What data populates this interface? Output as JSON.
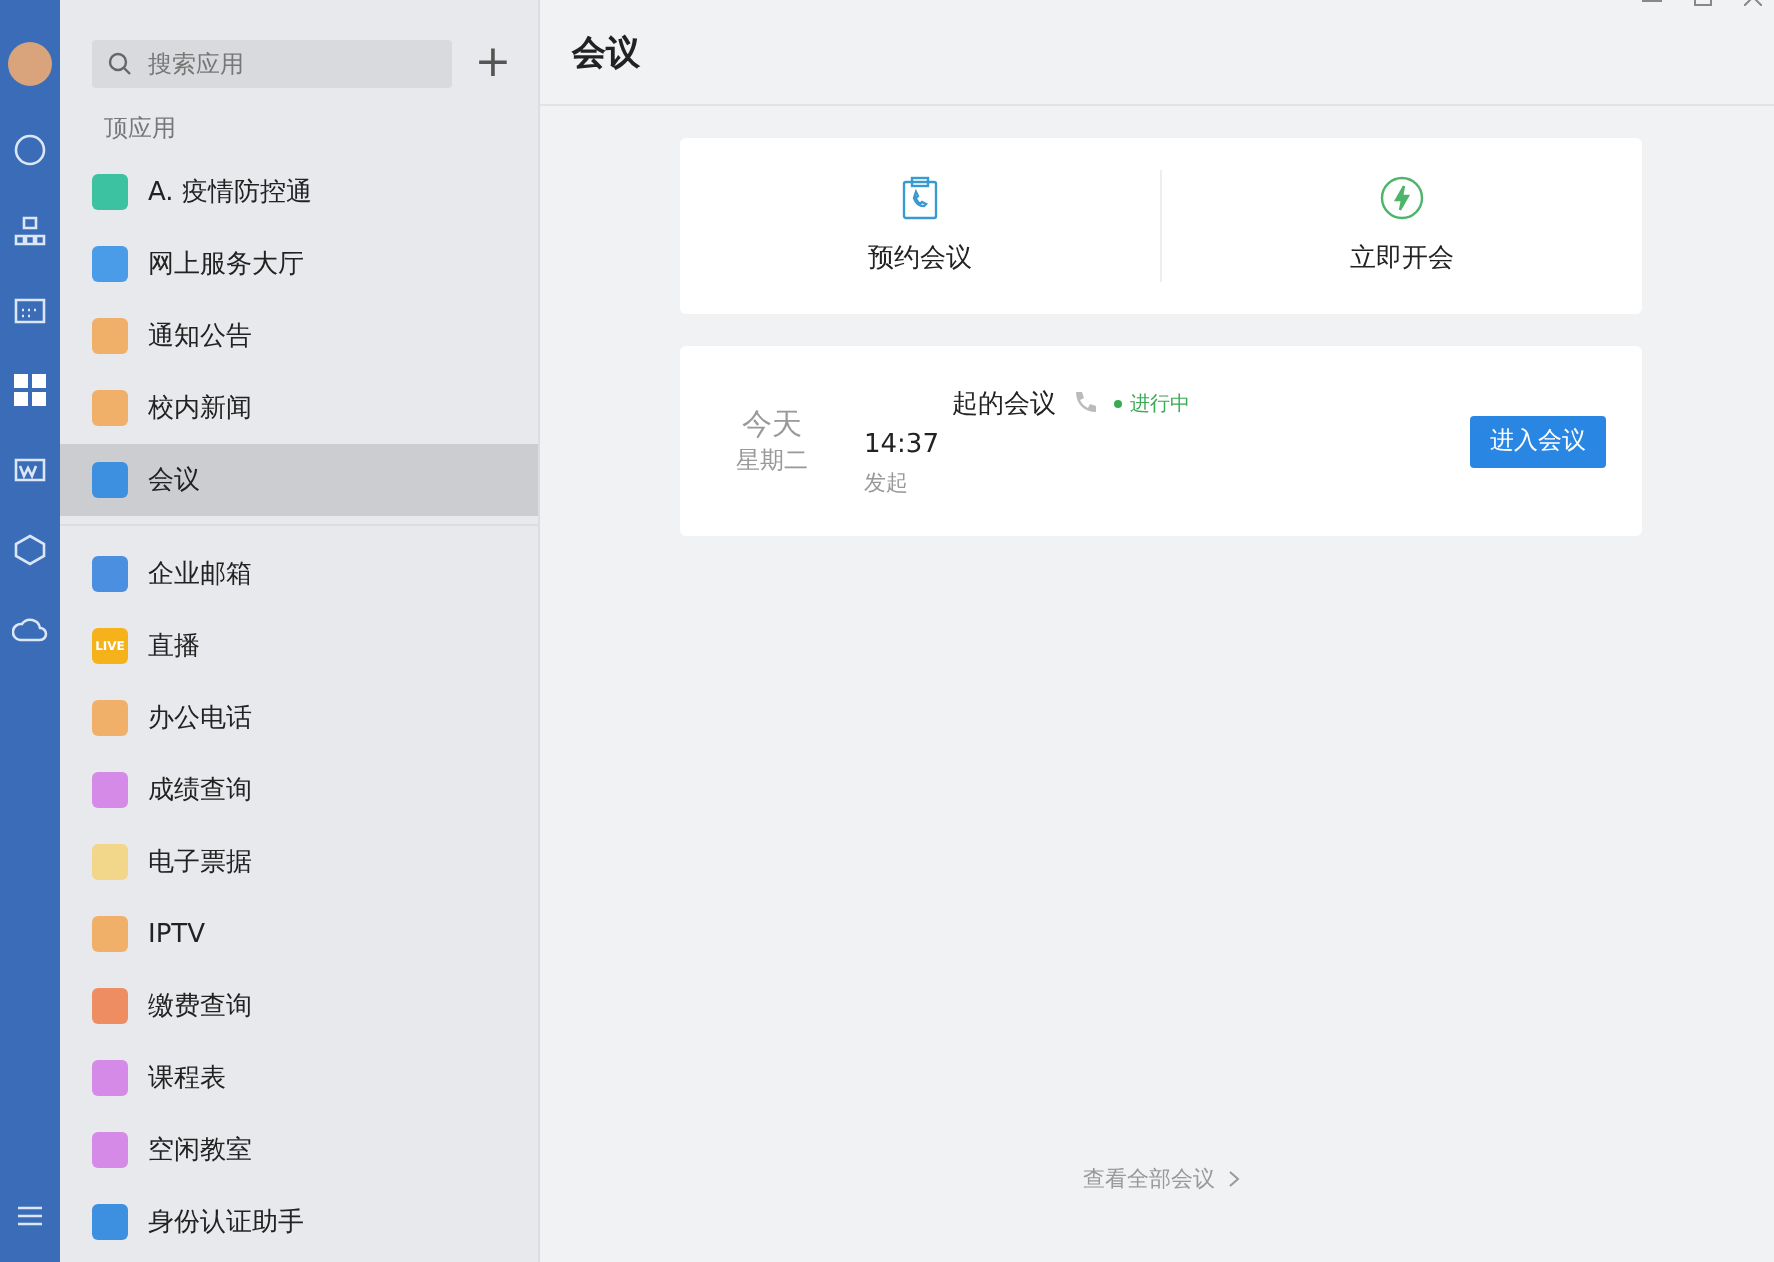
{
  "search": {
    "placeholder": "搜索应用"
  },
  "add_button": "+",
  "pinned_heading": "顶应用",
  "pinned_apps": [
    {
      "label": "A. 疫情防控通",
      "color": "#3cc2a0",
      "selected": false
    },
    {
      "label": "网上服务大厅",
      "color": "#4a9be8",
      "selected": false
    },
    {
      "label": "通知公告",
      "color": "#f0b06a",
      "selected": false
    },
    {
      "label": "校内新闻",
      "color": "#f0b06a",
      "selected": false
    },
    {
      "label": "会议",
      "color": "#3d8fe0",
      "selected": true
    }
  ],
  "apps": [
    {
      "label": "企业邮箱",
      "color": "#4a8fe0",
      "selected": false
    },
    {
      "label": "直播",
      "color": "#f5b21a",
      "selected": false,
      "badge": "LIVE"
    },
    {
      "label": "办公电话",
      "color": "#f0b06a",
      "selected": false
    },
    {
      "label": "成绩查询",
      "color": "#d58ae8",
      "selected": false
    },
    {
      "label": "电子票据",
      "color": "#f2d68a",
      "selected": false
    },
    {
      "label": "IPTV",
      "color": "#f0b06a",
      "selected": false
    },
    {
      "label": "缴费查询",
      "color": "#ee8c62",
      "selected": false
    },
    {
      "label": "课程表",
      "color": "#d58ae8",
      "selected": false
    },
    {
      "label": "空闲教室",
      "color": "#d58ae8",
      "selected": false
    },
    {
      "label": "身份认证助手",
      "color": "#3d8fe0",
      "selected": false
    }
  ],
  "page_title": "会议",
  "actions": [
    {
      "label": "预约会议",
      "kind": "schedule"
    },
    {
      "label": "立即开会",
      "kind": "instant"
    }
  ],
  "meeting": {
    "day": "今天",
    "weekday": "星期二",
    "title": "起的会议",
    "status": "进行中",
    "time": "14:37",
    "initiator": "发起",
    "button": "进入会议"
  },
  "view_all": "查看全部会议"
}
